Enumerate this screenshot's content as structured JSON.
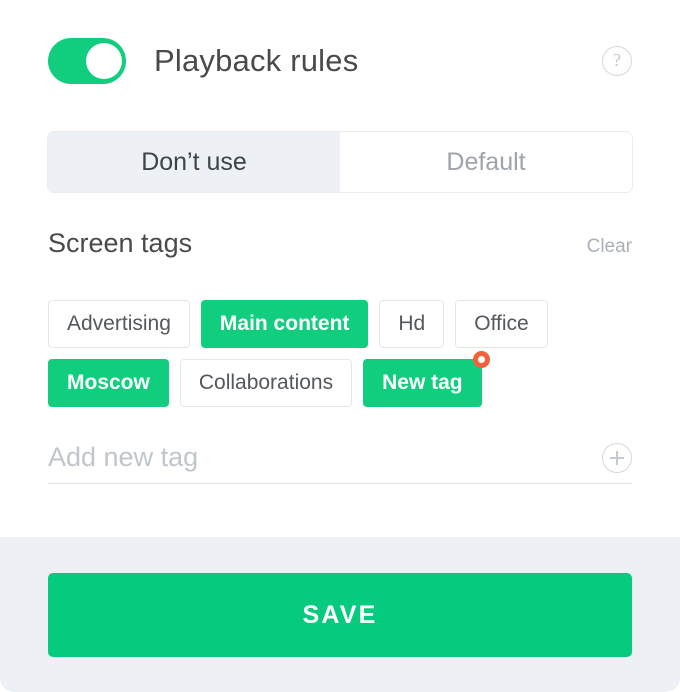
{
  "header": {
    "toggle_state": "on",
    "title": "Playback rules",
    "help_glyph": "?"
  },
  "mode_tabs": {
    "selected": "Don't use",
    "options": [
      {
        "label": "Don’t use",
        "active": true
      },
      {
        "label": "Default",
        "active": false
      }
    ]
  },
  "screen_tags": {
    "title": "Screen tags",
    "clear_label": "Clear",
    "rows": [
      [
        {
          "label": "Advertising",
          "selected": false,
          "badge": false
        },
        {
          "label": "Main content",
          "selected": true,
          "badge": false
        },
        {
          "label": "Hd",
          "selected": false,
          "badge": false
        },
        {
          "label": "Office",
          "selected": false,
          "badge": false
        }
      ],
      [
        {
          "label": "Moscow",
          "selected": true,
          "badge": false
        },
        {
          "label": "Collaborations",
          "selected": false,
          "badge": false
        },
        {
          "label": "New tag",
          "selected": true,
          "badge": true
        }
      ]
    ]
  },
  "add_tag": {
    "value": "",
    "placeholder": "Add new tag",
    "add_icon": "plus-circle-icon"
  },
  "footer": {
    "save_label": "SAVE"
  },
  "colors": {
    "accent_green": "#10ce7e",
    "save_green": "#06cb7f",
    "badge_orange": "#f4603a",
    "footer_bg": "#edf1f5",
    "tab_active_bg": "#edf1f5",
    "text_dark": "#4a4a4d",
    "text_muted": "#a9b0b7"
  }
}
